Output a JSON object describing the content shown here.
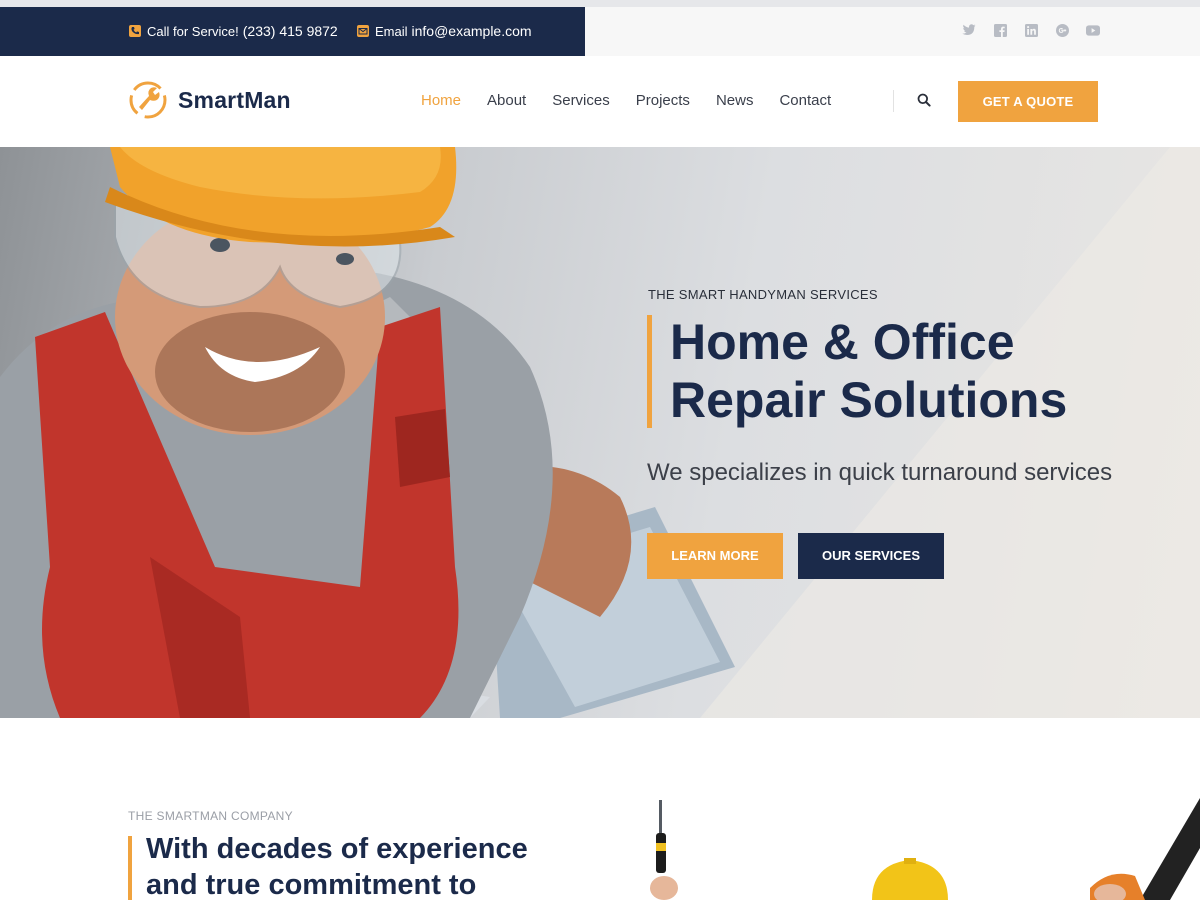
{
  "topbar": {
    "phone_label": "Call for Service!",
    "phone": "(233) 415 9872",
    "email_label": "Email",
    "email": "info@example.com",
    "socials": [
      "twitter-icon",
      "facebook-icon",
      "linkedin-icon",
      "google-plus-icon",
      "youtube-icon"
    ]
  },
  "brand": {
    "name": "SmartMan",
    "color": "#1b2a4a",
    "accent": "#f0a33f"
  },
  "nav": {
    "items": [
      {
        "label": "Home",
        "active": true
      },
      {
        "label": "About"
      },
      {
        "label": "Services"
      },
      {
        "label": "Projects"
      },
      {
        "label": "News"
      },
      {
        "label": "Contact"
      }
    ],
    "search_icon": "search-icon",
    "cta": "GET A QUOTE"
  },
  "hero": {
    "eyebrow": "THE SMART HANDYMAN SERVICES",
    "title_line1": "Home & Office",
    "title_line2": "Repair Solutions",
    "subtitle": "We specializes in quick turnaround services",
    "btn_primary": "LEARN MORE",
    "btn_secondary": "OUR SERVICES"
  },
  "about": {
    "eyebrow": "THE SMARTMAN COMPANY",
    "title_line1": "With decades of experience",
    "title_line2": "and true commitment to"
  }
}
